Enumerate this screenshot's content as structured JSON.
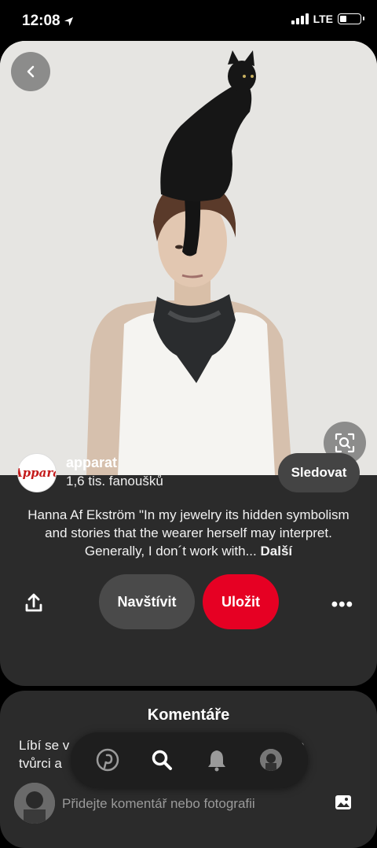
{
  "status_bar": {
    "time": "12:08",
    "network": "LTE"
  },
  "pin": {
    "image_alt": "Hanna Af Ekström"
  },
  "creator": {
    "name": "apparat",
    "followers": "1,6 tis. fanoušků",
    "avatar_text": "Appara",
    "follow_label": "Sledovat"
  },
  "description": {
    "text": "Hanna Af Ekström \"In my jewelry its hidden symbolism and stories that the wearer herself may interpret. Generally, I don´t work with...",
    "more_label": "Další"
  },
  "actions": {
    "visit_label": "Navštívit",
    "save_label": "Uložit",
    "more_icon": "•••"
  },
  "comments": {
    "title": "Komentáře",
    "prompt_left": "Líbí se v",
    "prompt_right": "o",
    "prompt_line2": "tvůrci a",
    "input_placeholder": "Přidejte komentář nebo fotografii"
  },
  "colors": {
    "save": "#e60023",
    "card": "#2b2b2b"
  }
}
